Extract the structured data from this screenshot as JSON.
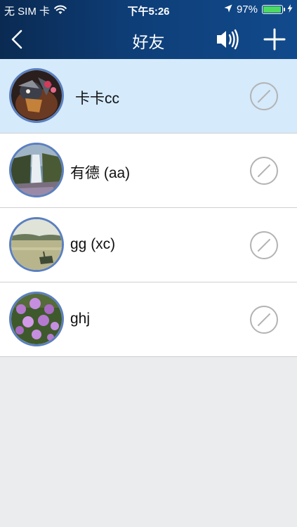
{
  "status_bar": {
    "carrier": "无 SIM 卡",
    "time": "下午5:26",
    "battery_percent": "97%",
    "battery_level": 0.97,
    "icons": [
      "wifi-icon",
      "location-arrow-icon",
      "battery-icon",
      "charging-bolt-icon"
    ]
  },
  "nav": {
    "title": "好友",
    "back_icon": "chevron-left-icon",
    "speaker_icon": "speaker-volume-icon",
    "add_icon": "plus-icon"
  },
  "friends": [
    {
      "name": "卡卡cc",
      "selected": true,
      "avatar": "armored-figure"
    },
    {
      "name": "有德 (aa)",
      "selected": false,
      "avatar": "waterfall"
    },
    {
      "name": "gg (xc)",
      "selected": false,
      "avatar": "lake"
    },
    {
      "name": "ghj",
      "selected": false,
      "avatar": "purple-flowers"
    }
  ],
  "row_action_icon": "block-circle-slash-icon",
  "colors": {
    "header_start": "#0a2a52",
    "header_end": "#114a8c",
    "selected_row": "#d5eafb",
    "avatar_ring": "#5b7fbf",
    "page_bg": "#ebecee",
    "battery_fill": "#4cd964"
  }
}
